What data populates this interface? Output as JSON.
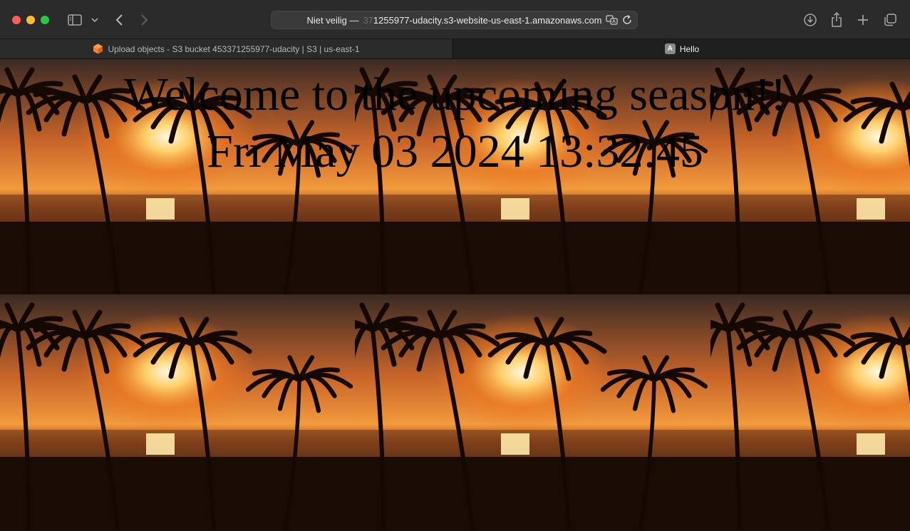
{
  "browser": {
    "address": {
      "insecure_label": "Niet veilig —",
      "url_faded": "37",
      "url": "1255977-udacity.s3-website-us-east-1.amazonaws.com"
    },
    "tabs": [
      {
        "label": "Upload objects - S3 bucket 453371255977-udacity | S3 | us-east-1",
        "icon": "aws-icon",
        "active": false
      },
      {
        "label": "Hello",
        "icon_letter": "A",
        "active": true
      }
    ]
  },
  "page": {
    "heading": "Welcome to the upcoming season!!",
    "datetime": "Fri May 03 2024 13:32:45",
    "background_image": "tropical-sunset-palm-trees"
  }
}
